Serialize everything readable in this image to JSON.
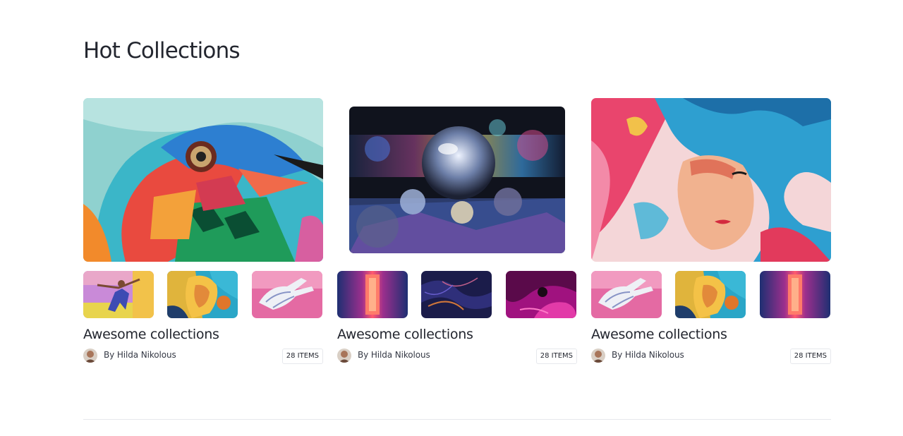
{
  "section": {
    "title": "Hot Collections"
  },
  "collections": [
    {
      "title": "Awesome collections",
      "author": "By Hilda Nikolous",
      "items_badge": "28 ITEMS",
      "hero_icon": "graffiti-bird-image",
      "thumb_icons": [
        "dancer-mural-image",
        "pop-art-woman-image",
        "hand-mural-image"
      ]
    },
    {
      "title": "Awesome collections",
      "author": "By Hilda Nikolous",
      "items_badge": "28 ITEMS",
      "hero_icon": "glass-sphere-image",
      "thumb_icons": [
        "neon-corridor-image",
        "dark-abstract-image",
        "magenta-swirl-image"
      ]
    },
    {
      "title": "Awesome collections",
      "author": "By Hilda Nikolous",
      "items_badge": "28 ITEMS",
      "hero_icon": "watercolor-face-image",
      "thumb_icons": [
        "hand-mural-image",
        "pop-art-woman-image",
        "neon-corridor-image"
      ]
    }
  ],
  "colors": {
    "text_primary": "#23262f",
    "text_secondary": "#353945",
    "border": "#e6e8ec",
    "background": "#ffffff"
  }
}
